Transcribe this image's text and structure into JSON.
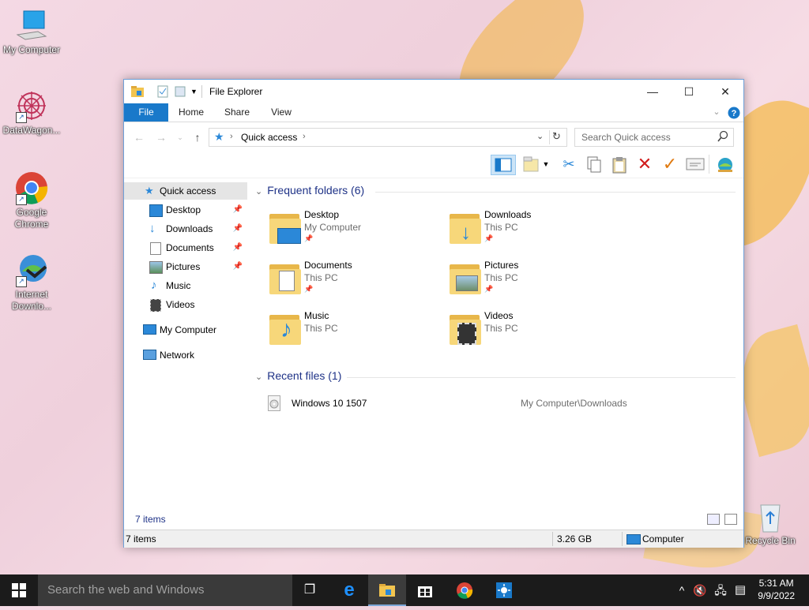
{
  "desktop": {
    "icons": [
      {
        "label": "My Computer"
      },
      {
        "label": "DataWagon..."
      },
      {
        "label": "Google Chrome"
      },
      {
        "label": "Internet Downlo..."
      },
      {
        "label": "Recycle Bin"
      }
    ]
  },
  "window": {
    "title": "File Explorer",
    "controls": {
      "minimize": "—",
      "maximize": "☐",
      "close": "✕"
    },
    "ribbon_tabs": [
      "File",
      "Home",
      "Share",
      "View"
    ],
    "address": {
      "root_icon": "quick-access-star-icon",
      "path": "Quick access"
    },
    "search": {
      "placeholder": "Search Quick access"
    },
    "nav_pane": {
      "quick_access": "Quick access",
      "items": [
        "Desktop",
        "Downloads",
        "Documents",
        "Pictures",
        "Music",
        "Videos"
      ],
      "my_computer": "My Computer",
      "network": "Network"
    },
    "frequent": {
      "header": "Frequent folders (6)",
      "folders": [
        {
          "name": "Desktop",
          "location": "My Computer"
        },
        {
          "name": "Downloads",
          "location": "This PC"
        },
        {
          "name": "Documents",
          "location": "This PC"
        },
        {
          "name": "Pictures",
          "location": "This PC"
        },
        {
          "name": "Music",
          "location": "This PC"
        },
        {
          "name": "Videos",
          "location": "This PC"
        }
      ]
    },
    "recent": {
      "header": "Recent files (1)",
      "files": [
        {
          "name": "Windows 10 1507",
          "path": "My Computer\\Downloads"
        }
      ]
    },
    "items_count": "7 items",
    "statusbar": {
      "items": "7 items",
      "size": "3.26 GB",
      "location": "Computer"
    }
  },
  "taskbar": {
    "search_placeholder": "Search the web and Windows",
    "time": "5:31 AM",
    "date": "9/9/2022"
  },
  "colors": {
    "accent": "#1979ca",
    "group_header": "#1e3287",
    "taskbar": "#1b1b1b"
  }
}
